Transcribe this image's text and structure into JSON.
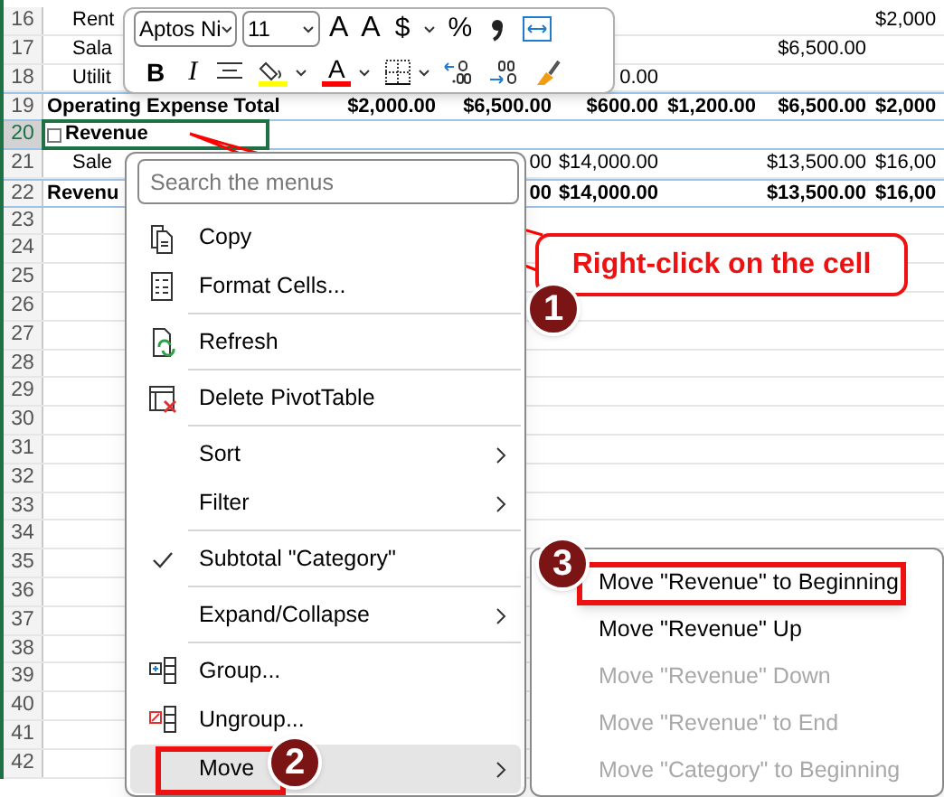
{
  "sheet": {
    "rows": [
      {
        "number": "16",
        "kind": "detail",
        "selected": false,
        "cells": {
          "column_a": "Rent",
          "column_g": "$2,000"
        }
      },
      {
        "number": "17",
        "kind": "detail",
        "selected": false,
        "cells": {
          "column_a": "Sala",
          "column_f": "$6,500.00"
        }
      },
      {
        "number": "18",
        "kind": "detail",
        "selected": false,
        "cells": {
          "column_a": "Utilit",
          "column_d": "0.00"
        }
      },
      {
        "number": "19",
        "kind": "total",
        "selected": false,
        "cells": {
          "column_a": "Operating Expense Total",
          "column_b": "$2,000.00",
          "column_c": "$6,500.00",
          "column_d": "$600.00",
          "column_e": "$1,200.00",
          "column_f": "$6,500.00",
          "column_g": "$2,000"
        }
      },
      {
        "number": "20",
        "kind": "group",
        "selected": true,
        "cells": {
          "column_a": "Revenue"
        }
      },
      {
        "number": "21",
        "kind": "detail",
        "selected": false,
        "cells": {
          "column_a": "Sale",
          "column_c": "00",
          "column_d": "$14,000.00",
          "column_f": "$13,500.00",
          "column_g": "$16,00"
        }
      },
      {
        "number": "22",
        "kind": "total",
        "selected": false,
        "cells": {
          "column_a": "Revenu",
          "column_c": "00",
          "column_d": "$14,000.00",
          "column_f": "$13,500.00",
          "column_g": "$16,00"
        }
      },
      {
        "number": "23",
        "kind": "empty",
        "selected": false
      },
      {
        "number": "24",
        "kind": "empty",
        "selected": false
      },
      {
        "number": "25",
        "kind": "empty",
        "selected": false
      },
      {
        "number": "26",
        "kind": "empty",
        "selected": false
      },
      {
        "number": "27",
        "kind": "empty",
        "selected": false
      },
      {
        "number": "28",
        "kind": "empty",
        "selected": false
      },
      {
        "number": "29",
        "kind": "empty",
        "selected": false
      },
      {
        "number": "30",
        "kind": "empty",
        "selected": false
      },
      {
        "number": "31",
        "kind": "empty",
        "selected": false
      },
      {
        "number": "32",
        "kind": "empty",
        "selected": false
      },
      {
        "number": "33",
        "kind": "empty",
        "selected": false
      },
      {
        "number": "34",
        "kind": "empty",
        "selected": false
      },
      {
        "number": "35",
        "kind": "empty",
        "selected": false
      },
      {
        "number": "36",
        "kind": "empty",
        "selected": false
      },
      {
        "number": "37",
        "kind": "empty",
        "selected": false
      },
      {
        "number": "38",
        "kind": "empty",
        "selected": false
      },
      {
        "number": "39",
        "kind": "empty",
        "selected": false
      },
      {
        "number": "40",
        "kind": "empty",
        "selected": false
      },
      {
        "number": "41",
        "kind": "empty",
        "selected": false
      },
      {
        "number": "42",
        "kind": "empty",
        "selected": false
      }
    ]
  },
  "mini_toolbar": {
    "font_name": "Aptos Ni",
    "font_size": "11",
    "row_1": [
      {
        "kind": "grow_font",
        "label": "A"
      },
      {
        "kind": "shrink_font",
        "label": "A"
      },
      {
        "kind": "currency",
        "label": "$"
      },
      {
        "kind": "dropdown"
      },
      {
        "kind": "percent",
        "label": "%"
      },
      {
        "kind": "comma_style"
      },
      {
        "kind": "wrap"
      }
    ],
    "row_2": [
      {
        "kind": "bold",
        "label": "B"
      },
      {
        "kind": "italic",
        "label": "I"
      },
      {
        "kind": "align"
      },
      {
        "kind": "fill_color",
        "color": "#ffff00"
      },
      {
        "kind": "dropdown"
      },
      {
        "kind": "font_color",
        "label": "A",
        "color": "#ff0000"
      },
      {
        "kind": "dropdown"
      },
      {
        "kind": "borders"
      },
      {
        "kind": "dropdown"
      },
      {
        "kind": "increase_decimal"
      },
      {
        "kind": "decrease_decimal"
      },
      {
        "kind": "format_painter"
      }
    ]
  },
  "context_menu": {
    "search": {
      "placeholder": "Search the menus"
    },
    "items": [
      {
        "kind": "item",
        "label": "Copy",
        "submenu": false,
        "checked": false,
        "selected": false,
        "highlighted": false
      },
      {
        "kind": "item",
        "label": "Format Cells...",
        "submenu": false,
        "checked": false,
        "selected": false,
        "highlighted": false
      },
      {
        "kind": "separator"
      },
      {
        "kind": "item",
        "label": "Refresh",
        "submenu": false,
        "checked": false,
        "selected": false,
        "highlighted": false
      },
      {
        "kind": "separator"
      },
      {
        "kind": "item",
        "label": "Delete PivotTable",
        "submenu": false,
        "checked": false,
        "selected": false,
        "highlighted": false
      },
      {
        "kind": "separator"
      },
      {
        "kind": "item",
        "label": "Sort",
        "submenu": true,
        "checked": false,
        "selected": false,
        "highlighted": false
      },
      {
        "kind": "item",
        "label": "Filter",
        "submenu": true,
        "checked": false,
        "selected": false,
        "highlighted": false
      },
      {
        "kind": "separator"
      },
      {
        "kind": "item",
        "label": "Subtotal \"Category\"",
        "submenu": false,
        "checked": true,
        "selected": false,
        "highlighted": false
      },
      {
        "kind": "separator"
      },
      {
        "kind": "item",
        "label": "Expand/Collapse",
        "submenu": true,
        "checked": false,
        "selected": false,
        "highlighted": false
      },
      {
        "kind": "separator"
      },
      {
        "kind": "item",
        "label": "Group...",
        "submenu": false,
        "checked": false,
        "selected": false,
        "highlighted": false
      },
      {
        "kind": "item",
        "label": "Ungroup...",
        "submenu": false,
        "checked": false,
        "selected": false,
        "highlighted": false
      },
      {
        "kind": "item",
        "label": "Move",
        "submenu": true,
        "checked": false,
        "selected": true,
        "highlighted": true
      }
    ]
  },
  "submenu": {
    "items": [
      {
        "label": "Move \"Revenue\" to Beginning",
        "disabled": false,
        "highlighted": true
      },
      {
        "label": "Move \"Revenue\" Up",
        "disabled": false,
        "highlighted": false
      },
      {
        "label": "Move \"Revenue\" Down",
        "disabled": true,
        "highlighted": false
      },
      {
        "label": "Move \"Revenue\" to End",
        "disabled": true,
        "highlighted": false
      },
      {
        "label": "Move \"Category\" to Beginning",
        "disabled": true,
        "highlighted": false
      }
    ]
  },
  "annotations": {
    "callout": "Right-click on the cell",
    "badges": [
      "1",
      "2",
      "3"
    ]
  }
}
